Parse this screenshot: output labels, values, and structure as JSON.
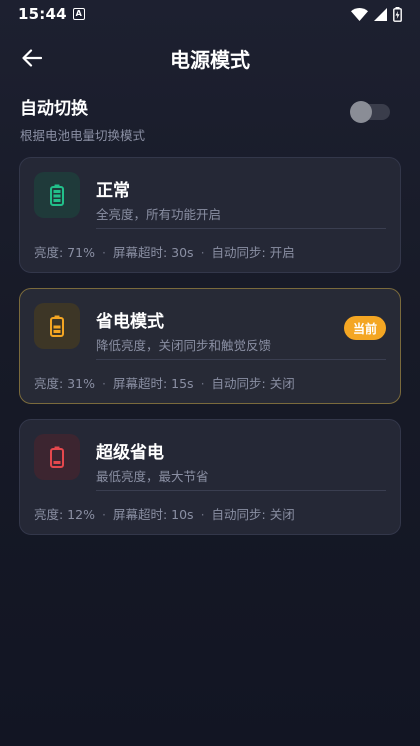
{
  "status_bar": {
    "time": "15:44",
    "notification_glyph": "A"
  },
  "header": {
    "title": "电源模式"
  },
  "auto_switch": {
    "title": "自动切换",
    "subtitle": "根据电池电量切换模式",
    "enabled": false
  },
  "modes": [
    {
      "title": "正常",
      "description": "全亮度，所有功能开启",
      "icon": "battery-full-icon",
      "color": "#22c08a",
      "icon_bg": "#1f3a3a",
      "stats": {
        "brightness": "亮度: 71%",
        "screen_timeout": "屏幕超时: 30s",
        "auto_sync": "自动同步: 开启"
      },
      "current": false
    },
    {
      "title": "省电模式",
      "description": "降低亮度，关闭同步和触觉反馈",
      "icon": "battery-half-icon",
      "color": "#f4a623",
      "icon_bg": "#3d3626",
      "stats": {
        "brightness": "亮度: 31%",
        "screen_timeout": "屏幕超时: 15s",
        "auto_sync": "自动同步: 关闭"
      },
      "current": true,
      "badge": "当前"
    },
    {
      "title": "超级省电",
      "description": "最低亮度，最大节省",
      "icon": "battery-low-icon",
      "color": "#e5484d",
      "icon_bg": "#3c2530",
      "stats": {
        "brightness": "亮度: 12%",
        "screen_timeout": "屏幕超时: 10s",
        "auto_sync": "自动同步: 关闭"
      },
      "current": false
    }
  ]
}
